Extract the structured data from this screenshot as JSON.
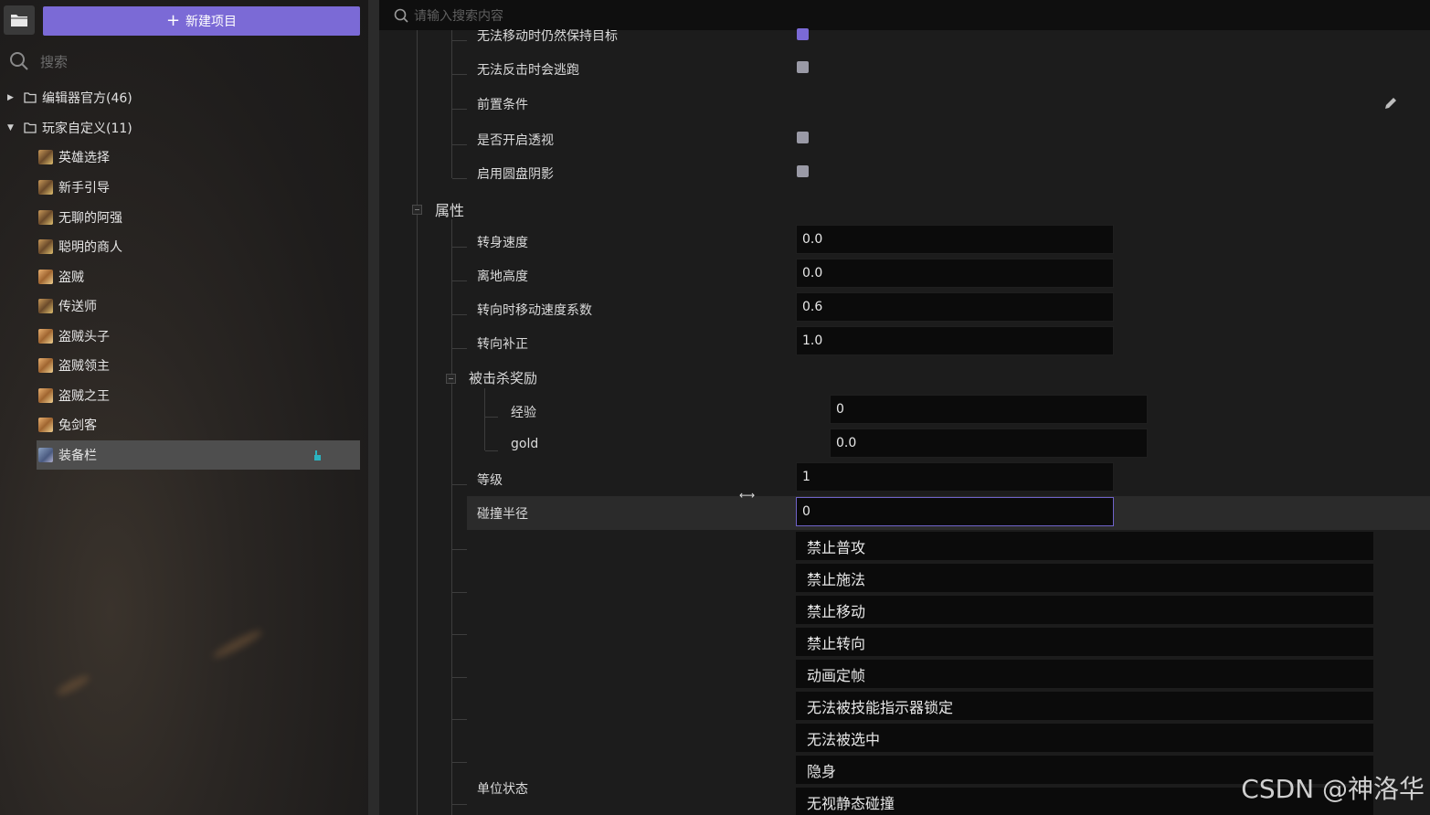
{
  "left_panel": {
    "new_project_label": "新建项目",
    "search_placeholder": "搜索",
    "groups": [
      {
        "label": "编辑器官方(46)",
        "expanded": false
      },
      {
        "label": "玩家自定义(11)",
        "expanded": true
      }
    ],
    "items": [
      {
        "label": "英雄选择",
        "avatar": "hero"
      },
      {
        "label": "新手引导",
        "avatar": "hero"
      },
      {
        "label": "无聊的阿强",
        "avatar": "hero"
      },
      {
        "label": "聪明的商人",
        "avatar": "hero"
      },
      {
        "label": "盗贼",
        "avatar": "thief"
      },
      {
        "label": "传送师",
        "avatar": "hero"
      },
      {
        "label": "盗贼头子",
        "avatar": "thief"
      },
      {
        "label": "盗贼领主",
        "avatar": "thief"
      },
      {
        "label": "盗贼之王",
        "avatar": "thief"
      },
      {
        "label": "兔剑客",
        "avatar": "thief"
      },
      {
        "label": "装备栏",
        "avatar": "equip",
        "selected": true
      }
    ]
  },
  "right_panel": {
    "search_placeholder": "请输入搜索内容",
    "top_rows": [
      {
        "label": "无法移动时仍然保持目标",
        "checked": true
      },
      {
        "label": "无法反击时会逃跑",
        "checked": false
      },
      {
        "label": "前置条件"
      },
      {
        "label": "是否开启透视",
        "checked": false
      },
      {
        "label": "启用圆盘阴影",
        "checked": false
      }
    ],
    "section_attributes": "属性",
    "attributes": [
      {
        "label": "转身速度",
        "value": "0.0"
      },
      {
        "label": "离地高度",
        "value": "0.0"
      },
      {
        "label": "转向时移动速度系数",
        "value": "0.6"
      },
      {
        "label": "转向补正",
        "value": "1.0"
      }
    ],
    "kill_reward": {
      "label": "被击杀奖励",
      "rows": [
        {
          "label": "经验",
          "value": "0"
        },
        {
          "label": "gold",
          "value": "0.0"
        }
      ]
    },
    "level": {
      "label": "等级",
      "value": "1"
    },
    "collision": {
      "label": "碰撞半径",
      "value": "0"
    },
    "unit_state": {
      "label": "单位状态",
      "items": [
        "禁止普攻",
        "禁止施法",
        "禁止移动",
        "禁止转向",
        "动画定帧",
        "无法被技能指示器锁定",
        "无法被选中",
        "隐身",
        "无视静态碰撞"
      ]
    }
  },
  "watermark": "CSDN @神洛华",
  "colors": {
    "accent": "#7b6ad6",
    "field_bg": "#0b0b0b",
    "panel_bg": "#1c1c1c"
  }
}
